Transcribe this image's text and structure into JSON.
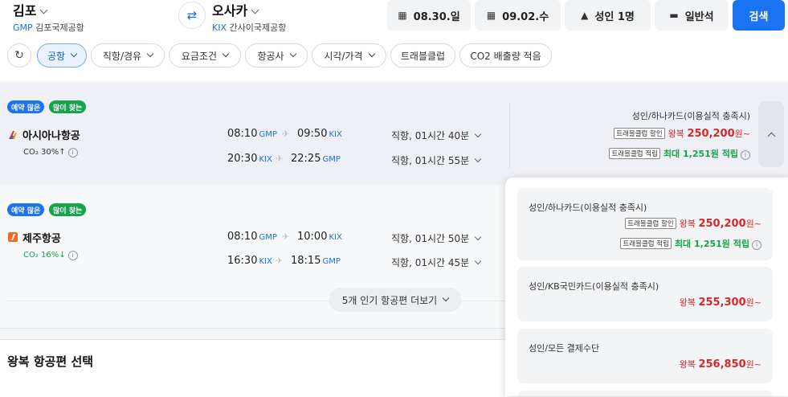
{
  "search": {
    "origin": {
      "city": "김포",
      "code": "GMP",
      "airport": "김포국제공항"
    },
    "destination": {
      "city": "오사카",
      "code": "KIX",
      "airport": "간사이국제공항"
    },
    "swap_icon": "⇄",
    "depart_date": "08.30.일",
    "return_date": "09.02.수",
    "passengers": "성인 1명",
    "cabin": "일반석",
    "search_label": "검색"
  },
  "filters": {
    "refresh_icon": "↻",
    "chips": [
      "공항",
      "직항/경유",
      "요금조건",
      "항공사",
      "시각/가격",
      "트래블클럽",
      "CO2 배출량 적음"
    ]
  },
  "results": [
    {
      "badges": [
        "예약 많은",
        "많이 찾는"
      ],
      "airline": "아시아나항공",
      "co2": "CO₂ 30%↑",
      "outbound": {
        "dep_time": "08:10",
        "dep_code": "GMP",
        "arr_time": "09:50",
        "arr_code": "KIX",
        "duration": "직항, 01시간 40분"
      },
      "inbound": {
        "dep_time": "20:30",
        "dep_code": "KIX",
        "arr_time": "22:25",
        "arr_code": "GMP",
        "duration": "직항, 01시간 55분"
      },
      "price": {
        "title": "성인/하나카드(이용실적 충족시)",
        "tag_discount": "트래블클럽 할인",
        "roundtrip": "왕복",
        "amount": "250,200",
        "unit": "원~",
        "tag_points": "트래블클럽 적립",
        "points": "최대 1,251원 적립"
      }
    },
    {
      "badges": [
        "예약 많은",
        "많이 찾는"
      ],
      "airline": "제주항공",
      "co2": "CO₂ 16%↓",
      "outbound": {
        "dep_time": "08:10",
        "dep_code": "GMP",
        "arr_time": "10:00",
        "arr_code": "KIX",
        "duration": "직항, 01시간 50분"
      },
      "inbound": {
        "dep_time": "16:30",
        "dep_code": "KIX",
        "arr_time": "18:15",
        "arr_code": "GMP",
        "duration": "직항, 01시간 45분"
      }
    }
  ],
  "more_label": "5개 인기 항공편 더보기",
  "section_title": "왕복 항공편 선택",
  "price_options": [
    {
      "title": "성인/하나카드(이용실적 충족시)",
      "tag_discount": "트래블클럽 할인",
      "roundtrip": "왕복",
      "amount": "250,200",
      "unit": "원~",
      "tag_points": "트래블클럽 적립",
      "points": "최대 1,251원 적립"
    },
    {
      "title": "성인/KB국민카드(이용실적 충족시)",
      "roundtrip": "왕복",
      "amount": "255,300",
      "unit": "원~"
    },
    {
      "title": "성인/모든 결제수단",
      "roundtrip": "왕복",
      "amount": "256,850",
      "unit": "원~"
    }
  ],
  "colors": {
    "accent": "#1a73f0",
    "price": "#d42a2a",
    "green": "#17a34a"
  }
}
